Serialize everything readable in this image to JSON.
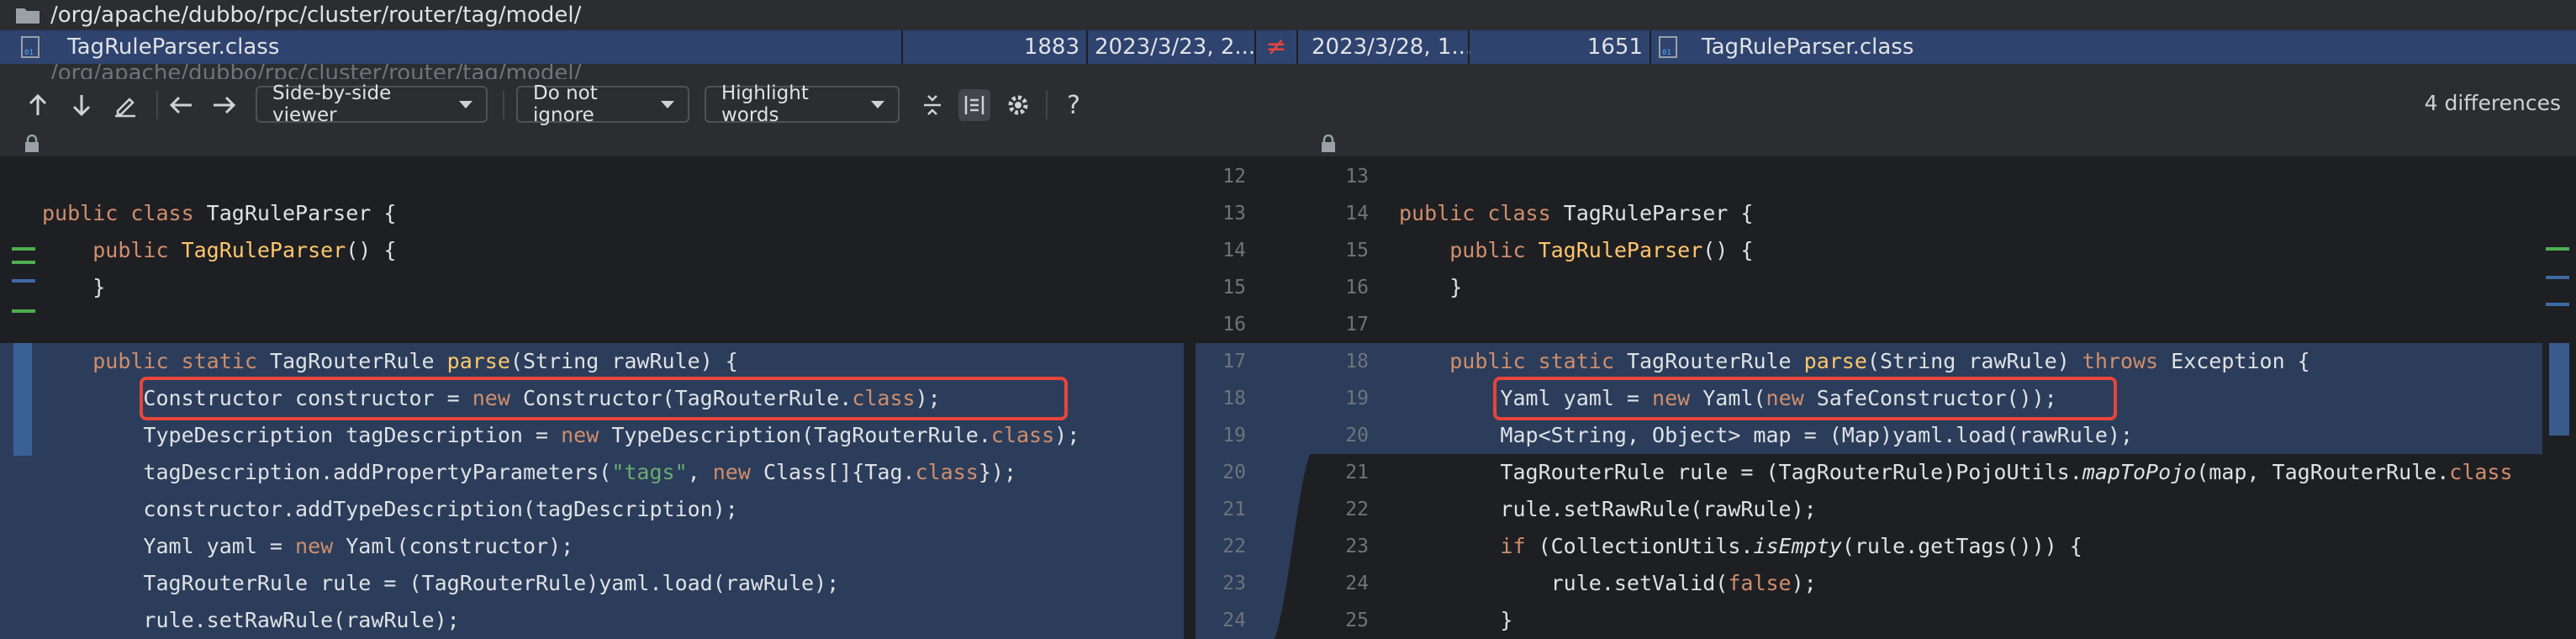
{
  "file_list": {
    "folder_path": "/org/apache/dubbo/rpc/cluster/router/tag/model/",
    "selected_row": {
      "left_name": "TagRuleParser.class",
      "left_size": "1883",
      "left_date": "2023/3/23, 2...",
      "diff_mark": "≠",
      "right_date": "2023/3/28, 1...",
      "right_size": "1651",
      "right_name": "TagRuleParser.class"
    },
    "partial_row": "/org/apache/dubbo/rpc/cluster/router/tag/model/"
  },
  "toolbar": {
    "viewer_label": "Side-by-side viewer",
    "ignore_label": "Do not ignore",
    "highlight_label": "Highlight words",
    "differences": "4 differences",
    "help": "?"
  },
  "left_lines": [
    "public class TagRuleParser {",
    "    public TagRuleParser() {",
    "    }",
    "",
    "    public static TagRouterRule parse(String rawRule) {",
    "        Constructor constructor = new Constructor(TagRouterRule.class);",
    "        TypeDescription tagDescription = new TypeDescription(TagRouterRule.class);",
    "        tagDescription.addPropertyParameters(\"tags\", new Class[]{Tag.class});",
    "        constructor.addTypeDescription(tagDescription);",
    "        Yaml yaml = new Yaml(constructor);",
    "        TagRouterRule rule = (TagRouterRule)yaml.load(rawRule);",
    "        rule.setRawRule(rawRule);"
  ],
  "right_lines": [
    "public class TagRuleParser {",
    "    public TagRuleParser() {",
    "    }",
    "",
    "    public static TagRouterRule parse(String rawRule) throws Exception {",
    "        Yaml yaml = new Yaml(new SafeConstructor());",
    "        Map<String, Object> map = (Map)yaml.load(rawRule);",
    "        TagRouterRule rule = (TagRouterRule)PojoUtils.mapToPojo(map, TagRouterRule.class",
    "        rule.setRawRule(rawRule);",
    "        if (CollectionUtils.isEmpty(rule.getTags())) {",
    "            rule.setValid(false);",
    "        }"
  ],
  "gutter": {
    "left_numbers": [
      "12",
      "13",
      "14",
      "15",
      "16",
      "17",
      "18",
      "19",
      "20",
      "21",
      "22",
      "23",
      "24"
    ],
    "right_numbers": [
      "13",
      "14",
      "15",
      "16",
      "17",
      "18",
      "19",
      "20",
      "21",
      "22",
      "23",
      "24",
      "25"
    ]
  },
  "colors": {
    "keyword": "#cf8e6d",
    "method": "#56a8f5",
    "string": "#6aab73",
    "changed_bg": "#2b3d5a",
    "annotation_box": "#e8453c"
  }
}
